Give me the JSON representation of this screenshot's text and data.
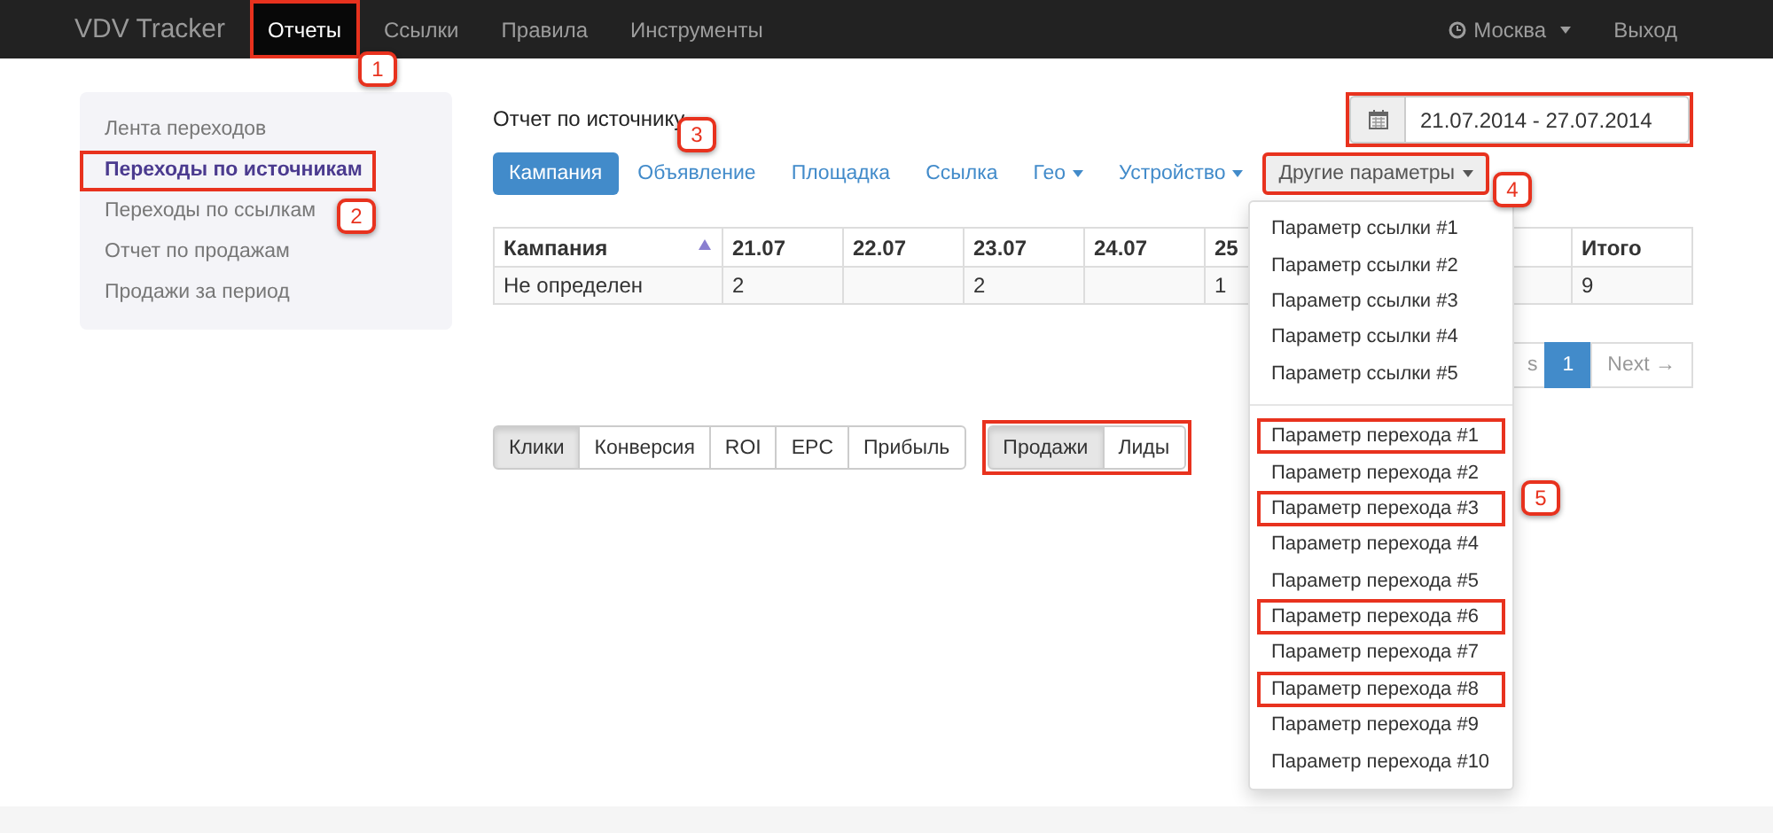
{
  "navbar": {
    "brand": "VDV Tracker",
    "items": [
      {
        "label": "Отчеты",
        "selected": true,
        "highlighted": true
      },
      {
        "label": "Ссылки",
        "selected": false,
        "highlighted": false
      },
      {
        "label": "Правила",
        "selected": false,
        "highlighted": false
      },
      {
        "label": "Инструменты",
        "selected": false,
        "highlighted": false
      }
    ],
    "city": "Москва",
    "logout": "Выход"
  },
  "sidebar": {
    "items": [
      {
        "label": "Лента переходов",
        "selected": false,
        "highlighted": false
      },
      {
        "label": "Переходы по источникам",
        "selected": true,
        "highlighted": true
      },
      {
        "label": "Переходы по ссылкам",
        "selected": false,
        "highlighted": false
      },
      {
        "label": "Отчет по продажам",
        "selected": false,
        "highlighted": false
      },
      {
        "label": "Продажи за период",
        "selected": false,
        "highlighted": false
      }
    ]
  },
  "report_title": "Отчет по источнику",
  "date_range": {
    "value": "21.07.2014 - 27.07.2014",
    "highlighted": true
  },
  "tabs": [
    {
      "label": "Кампания",
      "selected": true,
      "dropdown": false,
      "highlighted": false
    },
    {
      "label": "Объявление",
      "selected": false,
      "dropdown": false,
      "highlighted": false
    },
    {
      "label": "Площадка",
      "selected": false,
      "dropdown": false,
      "highlighted": false
    },
    {
      "label": "Ссылка",
      "selected": false,
      "dropdown": false,
      "highlighted": false
    },
    {
      "label": "Гео",
      "selected": false,
      "dropdown": true,
      "highlighted": false
    },
    {
      "label": "Устройство",
      "selected": false,
      "dropdown": true,
      "highlighted": false
    },
    {
      "label": "Другие параметры",
      "selected": false,
      "dropdown": true,
      "highlighted": true,
      "open": true
    }
  ],
  "dropdown_menu": {
    "groups": [
      [
        {
          "label": "Параметр ссылки #1",
          "highlighted": false
        },
        {
          "label": "Параметр ссылки #2",
          "highlighted": false
        },
        {
          "label": "Параметр ссылки #3",
          "highlighted": false
        },
        {
          "label": "Параметр ссылки #4",
          "highlighted": false
        },
        {
          "label": "Параметр ссылки #5",
          "highlighted": false
        }
      ],
      [
        {
          "label": "Параметр перехода #1",
          "highlighted": true
        },
        {
          "label": "Параметр перехода #2",
          "highlighted": false
        },
        {
          "label": "Параметр перехода #3",
          "highlighted": true
        },
        {
          "label": "Параметр перехода #4",
          "highlighted": false
        },
        {
          "label": "Параметр перехода #5",
          "highlighted": false
        },
        {
          "label": "Параметр перехода #6",
          "highlighted": true
        },
        {
          "label": "Параметр перехода #7",
          "highlighted": false
        },
        {
          "label": "Параметр перехода #8",
          "highlighted": true
        },
        {
          "label": "Параметр перехода #9",
          "highlighted": false
        },
        {
          "label": "Параметр перехода #10",
          "highlighted": false
        }
      ]
    ]
  },
  "table": {
    "columns": [
      {
        "label": "Кампания",
        "sorted": true
      },
      {
        "label": "21.07",
        "sorted": false
      },
      {
        "label": "22.07",
        "sorted": false
      },
      {
        "label": "23.07",
        "sorted": false
      },
      {
        "label": "24.07",
        "sorted": false
      },
      {
        "label": "25",
        "sorted": false
      },
      {
        "label": "Итого",
        "sorted": false
      }
    ],
    "rows": [
      [
        "Не определен",
        "2",
        null,
        "2",
        null,
        "1",
        "9"
      ]
    ]
  },
  "pagination": [
    {
      "label": "s",
      "selected": false
    },
    {
      "label": "1",
      "selected": true
    },
    {
      "label": "Next →",
      "selected": false
    }
  ],
  "metric_groups": [
    {
      "highlighted": false,
      "buttons": [
        {
          "label": "Клики",
          "selected": true
        },
        {
          "label": "Конверсия",
          "selected": false
        },
        {
          "label": "ROI",
          "selected": false
        },
        {
          "label": "EPC",
          "selected": false
        },
        {
          "label": "Прибыль",
          "selected": false
        }
      ]
    },
    {
      "highlighted": true,
      "buttons": [
        {
          "label": "Продажи",
          "selected": true
        },
        {
          "label": "Лиды",
          "selected": false
        }
      ]
    }
  ],
  "callouts": [
    "1",
    "2",
    "3",
    "4",
    "5"
  ]
}
